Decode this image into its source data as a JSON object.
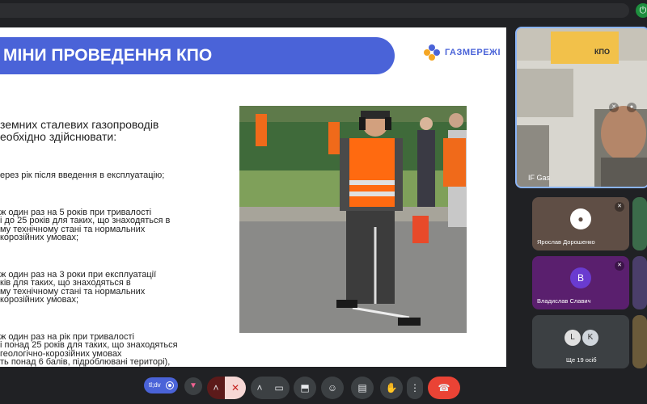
{
  "browser": {
    "ext_icon": "power-icon"
  },
  "slide": {
    "title": "МІНИ ПРОВЕДЕННЯ КПО",
    "logo_text": "ГАЗМЕРЕЖІ",
    "lead": "земних сталевих газопроводів\nеобхідно здійснювати:",
    "items": [
      "ерез рік після введення в експлуатацію;",
      "ж один раз на 5 років при тривалості\nі до 25 років для таких, що знаходяться в\nму технічному стані та нормальних\nкорозійних умовах;",
      "ж один раз на 3 роки при експлуатації\nків для таких, що знаходяться в\nму технічному стані та нормальних\nкорозійних умовах;",
      "ж один раз на рік при тривалості\nі понад 25 років для таких, що знаходяться\nгеологічно-корозійних умовах\nть понад 6 балів, підроблювані територі),\nсне покриття типу \"нормальне\", включені\nпітального ремонту або заміни."
    ],
    "brand_color": "#4a63d8"
  },
  "speaker": {
    "name": "IF Gas",
    "sign": "КПО"
  },
  "participants": [
    {
      "name": "Ярослав Дорошенко",
      "initial": "",
      "bg": "#5f4e45"
    },
    {
      "name": "Владислав Славич",
      "initial": "В",
      "bg": "#5a1f6e"
    },
    {
      "name": "Ще 19 осіб",
      "initial": "",
      "bg": "#3c4043"
    }
  ],
  "controls": {
    "tag_label": "tl;dv",
    "buttons": [
      "raise-icon",
      "chevron-up-icon",
      "mic-off-icon",
      "chevron-up-icon",
      "camera-icon",
      "present-icon",
      "emoji-icon",
      "captions-icon",
      "hand-icon",
      "more-icon",
      "hangup-icon"
    ]
  }
}
